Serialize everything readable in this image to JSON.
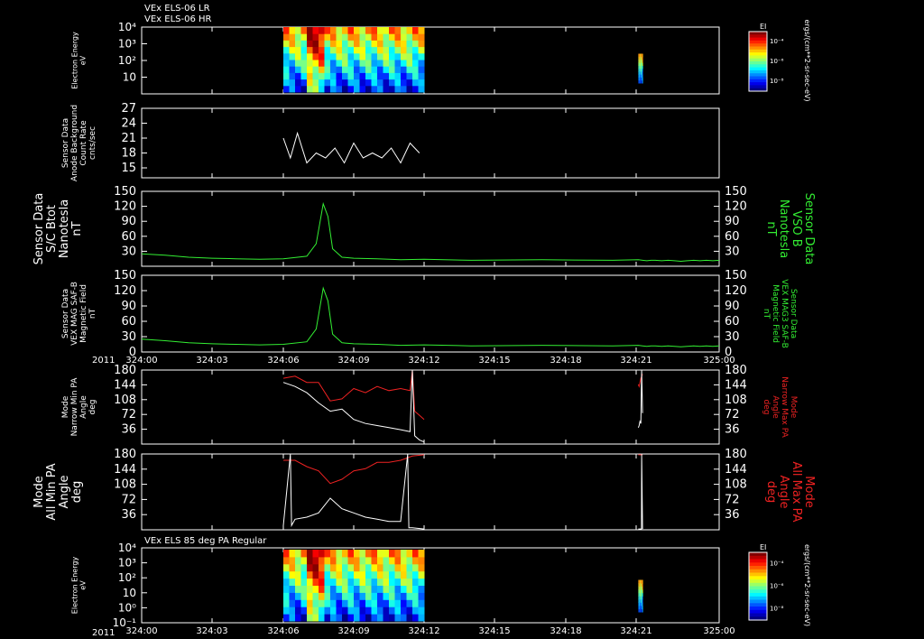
{
  "header": {
    "line1": "VEx ELS-06 LR",
    "line2": "VEx ELS-06 HR"
  },
  "colors": {
    "background": "#000000",
    "axis": "#ffffff",
    "green": "#33ee33",
    "red": "#ee2222",
    "white": "#ffffff"
  },
  "time_axis": {
    "year": "2011",
    "range_min": [
      0,
      60
    ],
    "tick_labels": [
      "324:00",
      "324:03",
      "324:06",
      "324:09",
      "324:12",
      "324:15",
      "324:18",
      "324:21",
      "325:00"
    ],
    "tick_minutes": [
      0,
      3,
      6,
      9,
      12,
      15,
      18,
      21,
      60
    ]
  },
  "chart_data": [
    {
      "id": "els-lr-hr-spectrogram",
      "type": "heatmap",
      "ylabel_lines": [
        "Electron Energy",
        "eV"
      ],
      "yscale": "log",
      "ylim": [
        1,
        10000
      ],
      "ytick_labels": [
        "10",
        "10²",
        "10³",
        "10⁴"
      ],
      "ytick_values": [
        10,
        100,
        1000,
        10000
      ],
      "x_blocks_min": [
        [
          6.0,
          12.0
        ],
        [
          22.0,
          24.0
        ]
      ],
      "colorbar": {
        "title": "EI",
        "tick_labels": [
          "10⁻⁴",
          "10⁻⁶",
          "10⁻⁸"
        ],
        "label": "ergs/(cm**2-sr-sec-eV)"
      }
    },
    {
      "id": "anode-background",
      "type": "line",
      "ylabel_lines": [
        "Sensor Data",
        "Anode Background",
        "Count Rate",
        "cnts/sec"
      ],
      "ylim": [
        13,
        27
      ],
      "yticks": [
        15,
        18,
        21,
        24,
        27
      ],
      "series": [
        {
          "color": "#ffffff",
          "x_min": [
            6.0,
            6.3,
            6.6,
            7.0,
            7.4,
            7.8,
            8.2,
            8.6,
            9.0,
            9.4,
            9.8,
            10.2,
            10.6,
            11.0,
            11.4,
            11.8
          ],
          "values": [
            21,
            17,
            22,
            16,
            18,
            17,
            19,
            16,
            20,
            17,
            18,
            17,
            19,
            16,
            20,
            18
          ]
        }
      ]
    },
    {
      "id": "sc-btot",
      "type": "line",
      "ylabel_lines": [
        "Sensor Data",
        "S/C Btot",
        "Nanotesla",
        "nT"
      ],
      "ylabel_right_lines": [
        "Sensor Data",
        "VSO B",
        "Nanotesla",
        "nT"
      ],
      "ylim": [
        0,
        150
      ],
      "yticks": [
        30,
        60,
        90,
        120,
        150
      ],
      "series": [
        {
          "color": "#33ee33",
          "x_min": [
            0,
            1,
            2,
            3,
            4,
            5,
            6,
            7,
            7.4,
            7.7,
            7.9,
            8.1,
            8.5,
            9,
            10,
            11,
            12,
            14,
            17,
            20,
            22,
            24,
            26,
            28,
            30,
            33,
            36,
            39,
            42,
            45,
            48,
            51,
            54,
            57,
            60
          ],
          "values": [
            25,
            22,
            18,
            16,
            15,
            14,
            15,
            20,
            45,
            125,
            100,
            35,
            18,
            16,
            15,
            13,
            14,
            12,
            13,
            12,
            13,
            12,
            11,
            12,
            12,
            11,
            12,
            11,
            10,
            11,
            12,
            11,
            12,
            11,
            12
          ]
        }
      ]
    },
    {
      "id": "mag-field",
      "type": "line",
      "ylabel_lines": [
        "Sensor Data",
        "VEX MAG SAF-B",
        "Magnetic Field",
        "nT"
      ],
      "ylabel_right_lines": [
        "Sensor Data",
        "VEX MAG3 SAF-B",
        "Magnetic Field",
        "nT"
      ],
      "ylim": [
        0,
        150
      ],
      "yticks": [
        0,
        30,
        60,
        90,
        120,
        150
      ],
      "series": [
        {
          "color": "#33ee33",
          "x_min": [
            0,
            1,
            2,
            3,
            4,
            5,
            6,
            7,
            7.4,
            7.7,
            7.9,
            8.1,
            8.5,
            9,
            10,
            11,
            12,
            14,
            17,
            20,
            22,
            24,
            26,
            28,
            30,
            33,
            36,
            39,
            42,
            45,
            48,
            51,
            54,
            57,
            60
          ],
          "values": [
            25,
            22,
            18,
            16,
            15,
            14,
            15,
            20,
            45,
            125,
            100,
            35,
            18,
            16,
            15,
            13,
            14,
            12,
            13,
            12,
            13,
            12,
            11,
            12,
            12,
            11,
            12,
            11,
            10,
            11,
            12,
            11,
            12,
            11,
            12
          ]
        }
      ]
    },
    {
      "id": "narrow-pa",
      "type": "line",
      "ylabel_lines": [
        "Mode",
        "Narrow Min PA",
        "Angle",
        "deg"
      ],
      "ylabel_right_lines": [
        "Mode",
        "Narrow Max PA",
        "Angle",
        "deg"
      ],
      "ylim": [
        0,
        180
      ],
      "yticks": [
        36,
        72,
        108,
        144,
        180
      ],
      "series": [
        {
          "color": "#ee2222",
          "x_min": [
            6.0,
            6.5,
            7.0,
            7.5,
            8.0,
            8.5,
            9.0,
            9.5,
            10.0,
            10.5,
            11.0,
            11.4,
            11.5,
            11.6,
            11.8,
            12.0
          ],
          "values": [
            160,
            165,
            150,
            150,
            105,
            110,
            135,
            125,
            140,
            130,
            135,
            130,
            180,
            80,
            70,
            60
          ]
        },
        {
          "color": "#ffffff",
          "x_min": [
            6.0,
            6.5,
            7.0,
            7.5,
            8.0,
            8.5,
            9.0,
            9.5,
            10.0,
            10.5,
            11.0,
            11.4,
            11.5,
            11.6,
            11.8,
            12.0
          ],
          "values": [
            150,
            140,
            125,
            100,
            80,
            85,
            60,
            50,
            45,
            40,
            35,
            30,
            180,
            20,
            10,
            5
          ]
        },
        {
          "color": "#ee2222",
          "x_min": [
            22.0,
            22.4,
            22.8,
            23.2,
            23.6,
            24.0
          ],
          "values": [
            145,
            140,
            150,
            160,
            165,
            170
          ]
        },
        {
          "color": "#ffffff",
          "x_min": [
            22.0,
            22.4,
            22.8,
            23.2,
            23.6,
            24.0
          ],
          "values": [
            40,
            45,
            55,
            50,
            180,
            75
          ]
        }
      ]
    },
    {
      "id": "all-pa",
      "type": "line",
      "ylabel_lines": [
        "Mode",
        "All Min PA",
        "Angle",
        "deg"
      ],
      "ylabel_right_lines": [
        "Mode",
        "All Max PA",
        "Angle",
        "deg"
      ],
      "ylim": [
        0,
        180
      ],
      "yticks": [
        36,
        72,
        108,
        144,
        180
      ],
      "series": [
        {
          "color": "#ee2222",
          "x_min": [
            6.0,
            6.5,
            7.0,
            7.5,
            8.0,
            8.5,
            9.0,
            9.5,
            10.0,
            10.5,
            11.0,
            11.5,
            12.0
          ],
          "values": [
            165,
            165,
            150,
            140,
            110,
            120,
            140,
            145,
            160,
            160,
            165,
            175,
            178
          ]
        },
        {
          "color": "#ffffff",
          "x_min": [
            6.0,
            6.3,
            6.35,
            6.5,
            7.0,
            7.5,
            8.0,
            8.5,
            9.0,
            9.5,
            10.0,
            10.5,
            11.0,
            11.3,
            11.35,
            11.5,
            12.0
          ],
          "values": [
            10,
            180,
            10,
            25,
            30,
            40,
            75,
            50,
            40,
            30,
            25,
            20,
            20,
            180,
            5,
            5,
            2
          ]
        },
        {
          "color": "#ee2222",
          "x_min": [
            22.0,
            23.0,
            24.0
          ],
          "values": [
            178,
            178,
            178
          ]
        },
        {
          "color": "#ffffff",
          "x_min": [
            22.0,
            23.0,
            23.5,
            23.6,
            24.0
          ],
          "values": [
            2,
            2,
            2,
            180,
            2
          ]
        }
      ]
    },
    {
      "id": "els-85deg-spectrogram",
      "type": "heatmap",
      "title": "VEx ELS 85 deg PA Regular",
      "ylabel_lines": [
        "Electron Energy",
        "eV"
      ],
      "yscale": "log",
      "ylim": [
        0.1,
        10000
      ],
      "ytick_labels": [
        "10⁻¹",
        "10⁰",
        "10",
        "10²",
        "10³",
        "10⁴"
      ],
      "ytick_values": [
        0.1,
        1,
        10,
        100,
        1000,
        10000
      ],
      "x_blocks_min": [
        [
          6.0,
          12.0
        ],
        [
          22.0,
          24.0
        ]
      ],
      "colorbar": {
        "title": "EI",
        "tick_labels": [
          "10⁻⁴",
          "10⁻⁶",
          "10⁻⁸"
        ],
        "label": "ergs/(cm**2-sr-sec-eV)"
      }
    }
  ]
}
